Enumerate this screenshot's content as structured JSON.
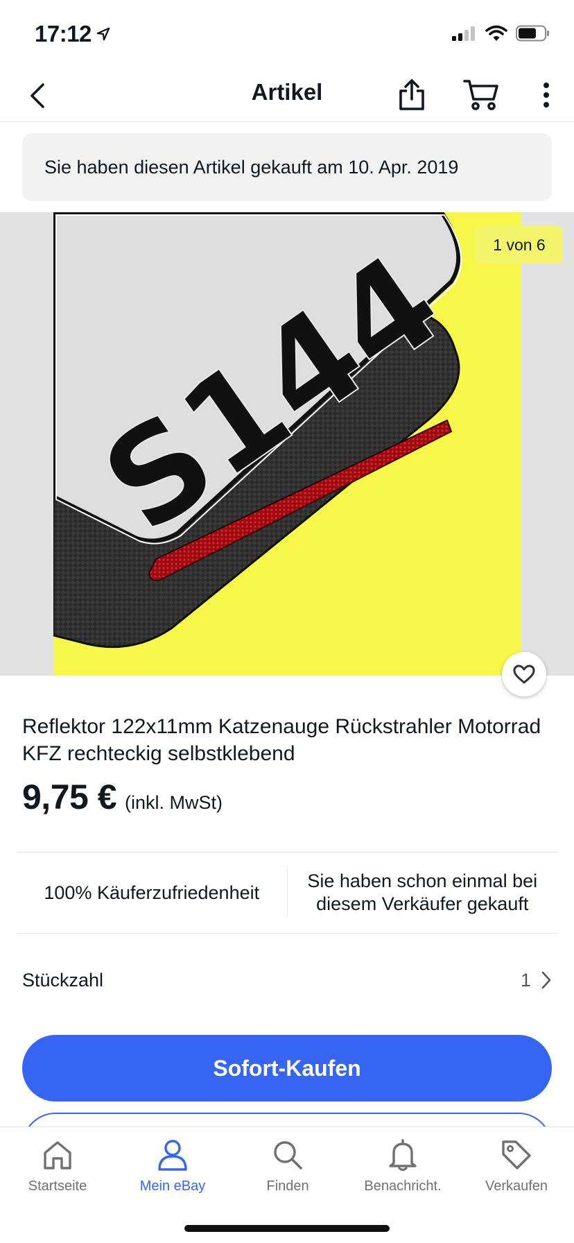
{
  "status_bar": {
    "time": "17:12"
  },
  "nav": {
    "title": "Artikel"
  },
  "purchase_notice": "Sie haben diesen Artikel gekauft am 10. Apr. 2019",
  "gallery": {
    "counter": "1 von 6",
    "plate_text": "S144"
  },
  "item": {
    "title": "Reflektor 122x11mm Katzenauge Rückstrahler Motorrad KFZ rechteckig selbstklebend",
    "price": "9,75 €",
    "price_note": "(inkl. MwSt)"
  },
  "seller": {
    "satisfaction": "100% Käuferzufriedenheit",
    "previous_purchase": "Sie haben schon einmal bei diesem Verkäufer gekauft"
  },
  "quantity": {
    "label": "Stückzahl",
    "value": "1"
  },
  "actions": {
    "buy_now": "Sofort-Kaufen"
  },
  "tabs": [
    {
      "label": "Startseite",
      "icon": "home-icon"
    },
    {
      "label": "Mein eBay",
      "icon": "profile-icon"
    },
    {
      "label": "Finden",
      "icon": "search-icon"
    },
    {
      "label": "Benachricht.",
      "icon": "bell-icon"
    },
    {
      "label": "Verkaufen",
      "icon": "tag-icon"
    }
  ],
  "colors": {
    "accent": "#3665f3",
    "counter_bg": "#f4f46a",
    "image_bg": "#f7f74a"
  }
}
